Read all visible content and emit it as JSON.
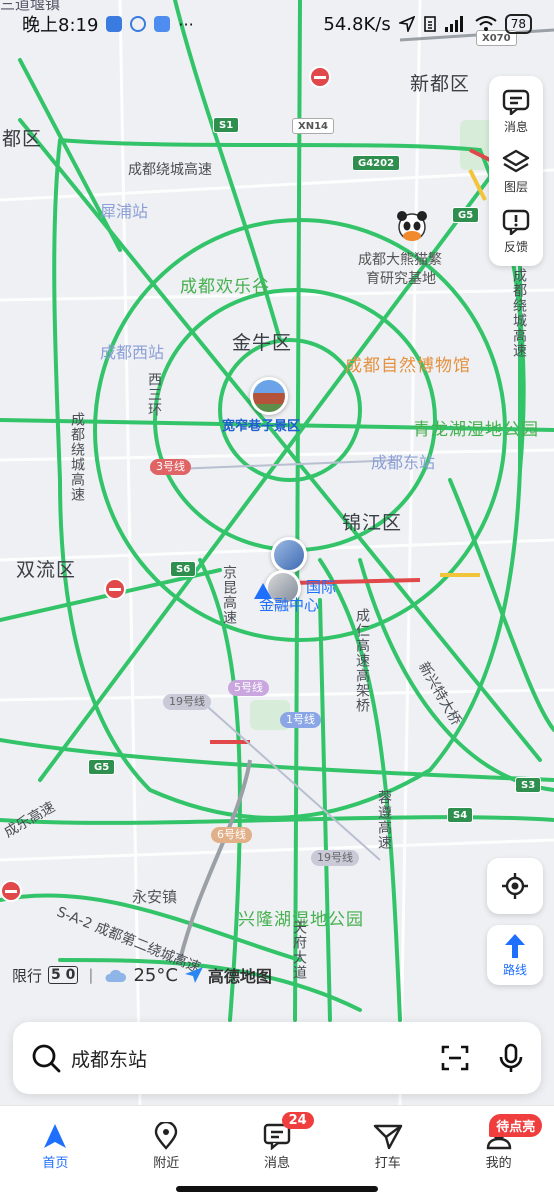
{
  "status_bar": {
    "time": "晚上8:19",
    "speed": "54.8K/s",
    "battery": "78"
  },
  "map": {
    "district_labels": [
      "新都区",
      "都区",
      "金牛区",
      "锦江区",
      "双流区"
    ],
    "poi_labels": {
      "panda_base_line1": "成都大熊猫繁",
      "panda_base_line2": "育研究基地",
      "happy_valley": "成都欢乐谷",
      "natural_museum": "成都自然博物馆",
      "qinglong_lake": "青龙湖湿地公园",
      "xinglong_lake": "兴隆湖湿地公园",
      "kuanzhai": "宽窄巷子景区",
      "yong_an": "永安镇",
      "sandao": "三道堰镇"
    },
    "station_labels": [
      "犀浦站",
      "成都西站",
      "成都东站"
    ],
    "road_labels": {
      "ring_highway": "成都绕城高速",
      "ring_highway_v": "成都绕城高速",
      "ring_highway_e": "成都绕城高速",
      "west_third_ring": "西三环",
      "jingkun": "京昆高速",
      "chengren": "成仁高速高架桥",
      "rongzun": "蓉遵高速",
      "xinxingtai": "新兴特大桥",
      "chengle": "成乐高速",
      "sa2": "S-A-2 成都第二绕城高速",
      "tianfu": "天府大道",
      "jinrong_line1": "金融中心",
      "jinrong_line0": "国际"
    },
    "road_shields": [
      "S1",
      "XN14",
      "G4202",
      "G5",
      "S6",
      "G5",
      "S3",
      "S4",
      "X070"
    ],
    "metro_lines": [
      "3号线",
      "19号线",
      "5号线",
      "1号线",
      "6号线",
      "19号线"
    ]
  },
  "tools": [
    {
      "label": "消息",
      "icon": "message-icon"
    },
    {
      "label": "图层",
      "icon": "layers-icon"
    },
    {
      "label": "反馈",
      "icon": "feedback-icon"
    }
  ],
  "route_button": {
    "label": "路线"
  },
  "info_row": {
    "restriction_label": "限行",
    "plate_numbers": "5 0",
    "temperature": "25°C",
    "brand": "高德地图"
  },
  "search": {
    "query": "成都东站"
  },
  "bottom_nav": [
    {
      "label": "首页",
      "icon": "navigation-arrow-icon",
      "active": true
    },
    {
      "label": "附近",
      "icon": "location-pin-icon"
    },
    {
      "label": "消息",
      "icon": "chat-icon",
      "badge": "24"
    },
    {
      "label": "打车",
      "icon": "taxi-icon"
    },
    {
      "label": "我的",
      "icon": "profile-icon",
      "badge": "待点亮"
    }
  ],
  "colors": {
    "road_green": "#33c46a",
    "road_red": "#e0484a",
    "road_yellow": "#f2c43a",
    "accent_blue": "#1f6fff",
    "badge_red": "#f03e3e"
  }
}
